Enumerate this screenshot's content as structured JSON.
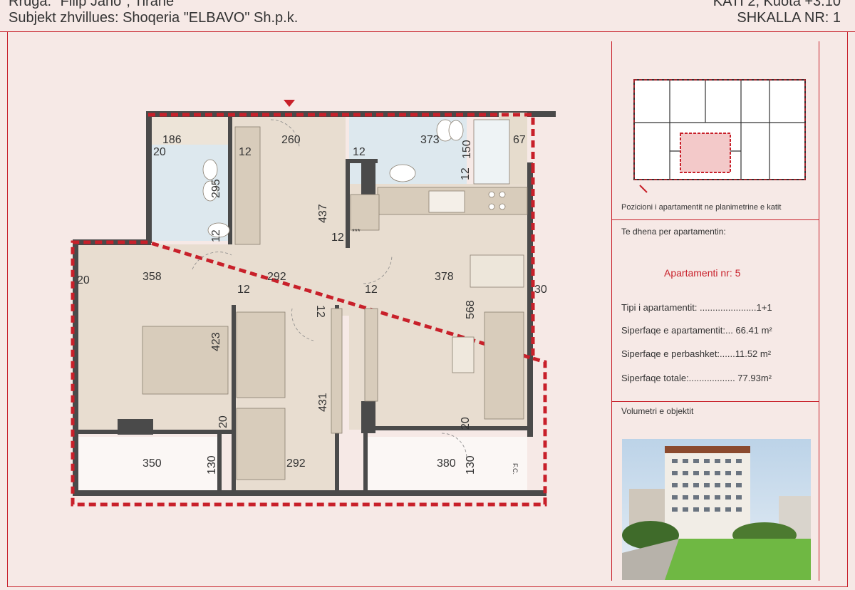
{
  "header": {
    "street": "Rruga: \"Filip Jano\", Tiranë",
    "developer": "Subjekt zhvillues: Shoqeria \"ELBAVO\" Sh.p.k.",
    "floor": "KATI 2, Kuota +3.10",
    "stair": "SHKALLA NR: 1"
  },
  "plan": {
    "dimensions": [
      "186",
      "20",
      "12",
      "260",
      "12",
      "373",
      "150",
      "67",
      "12",
      "295",
      "437",
      "12",
      "12",
      "358",
      "292",
      "378",
      "20",
      "12",
      "12",
      "12",
      "30",
      "568",
      "423",
      "431",
      "20",
      "350",
      "130",
      "292",
      "380",
      "130",
      "20"
    ],
    "symbols": {
      "fridge_label": "***",
      "closet_label": "F.C."
    }
  },
  "panel": {
    "position_caption": "Pozicioni i apartamentit ne planimetrine e katit",
    "info_heading": "Te dhena per apartamentin:",
    "apartment_number": "Apartamenti nr: 5",
    "type_row": "Tipi i apartamentit: ......................1+1",
    "area_apartment": "Siperfaqe e apartamentit:... 66.41 m²",
    "area_common": "Siperfaqe e perbashket:......11.52 m²",
    "area_total": "Siperfaqe totale:.................. 77.93m²",
    "volumetrics_heading": "Volumetri e objektit"
  },
  "colors": {
    "accent_red": "#c8202a",
    "wall": "#4a4a4a",
    "floor_wood": "#e8ddd0",
    "tile": "#dde8ee",
    "background": "#f6e9e6"
  }
}
